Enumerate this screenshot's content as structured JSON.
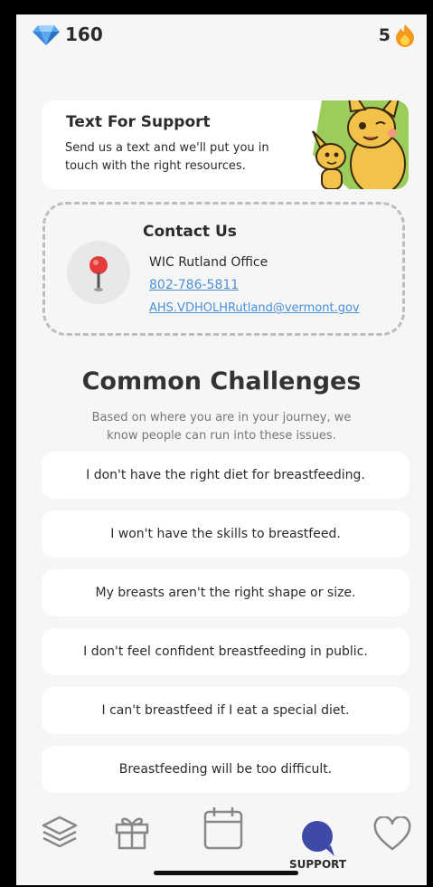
{
  "top_bar": {
    "gems": "160",
    "streak": "5"
  },
  "text_support": {
    "title": "Text For Support",
    "description": "Send us a text and we'll put you in touch with the right resources."
  },
  "contact": {
    "title": "Contact Us",
    "office": "WIC Rutland Office",
    "phone": "802-786-5811",
    "email": "AHS.VDHOLHRutland@vermont.gov"
  },
  "challenges": {
    "heading": "Common Challenges",
    "subheading": "Based on where you are in your journey, we know people can run into these issues.",
    "items": [
      "I don't have the right diet for breastfeeding.",
      "I won't have the skills to breastfeed.",
      "My breasts aren't the right shape or size.",
      "I don't feel confident breastfeeding in public.",
      "I can't breastfeed if I eat a special diet.",
      "Breastfeeding will be too difficult."
    ]
  },
  "nav": {
    "active_label": "SUPPORT"
  },
  "colors": {
    "accent": "#3f4aa8",
    "link": "#4a90d9",
    "card_green": "#9ccd5a",
    "mascot": "#f2c24a"
  },
  "icons": [
    "diamond-icon",
    "flame-icon",
    "map-pin-icon",
    "layers-icon",
    "gift-icon",
    "calendar-icon",
    "chat-bubble-icon",
    "heart-icon"
  ]
}
